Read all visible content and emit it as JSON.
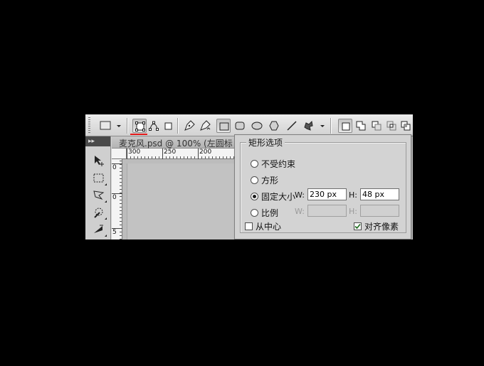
{
  "options_bar": {
    "tools": [
      {
        "icon": "shape-preset-icon"
      },
      {
        "icon": "shape-layers-icon"
      },
      {
        "icon": "paths-icon"
      },
      {
        "icon": "fill-pixels-icon"
      },
      {
        "icon": "pen-tool-icon"
      },
      {
        "icon": "freeform-pen-icon"
      },
      {
        "icon": "rectangle-tool-icon"
      },
      {
        "icon": "rounded-rectangle-tool-icon"
      },
      {
        "icon": "ellipse-tool-icon"
      },
      {
        "icon": "polygon-tool-icon"
      },
      {
        "icon": "line-tool-icon"
      },
      {
        "icon": "custom-shape-tool-icon"
      },
      {
        "icon": "new-shape-layer-icon"
      },
      {
        "icon": "add-to-shape-area-icon"
      },
      {
        "icon": "subtract-shape-area-icon"
      },
      {
        "icon": "intersect-shape-areas-icon"
      },
      {
        "icon": "exclude-overlap-icon"
      }
    ],
    "accent_color": "#e41b1b"
  },
  "document": {
    "tab_title": "麦克风.psd @ 100% (左圆标",
    "ruler_h_ticks": [
      "300",
      "250",
      "200"
    ],
    "ruler_v_ticks": [
      "0",
      "0",
      "5"
    ]
  },
  "rect_options": {
    "title": "矩形选项",
    "unconstrained": "不受约束",
    "square": "方形",
    "fixed_size": "固定大小",
    "proportional": "比例",
    "selected": "fixed_size",
    "w_label": "W:",
    "h_label": "H:",
    "fixed_w": "230 px",
    "fixed_h": "48 px",
    "prop_w": "",
    "prop_h": "",
    "from_center": "从中心",
    "from_center_checked": false,
    "snap_to_pixels": "对齐像素",
    "snap_to_pixels_checked": true
  }
}
